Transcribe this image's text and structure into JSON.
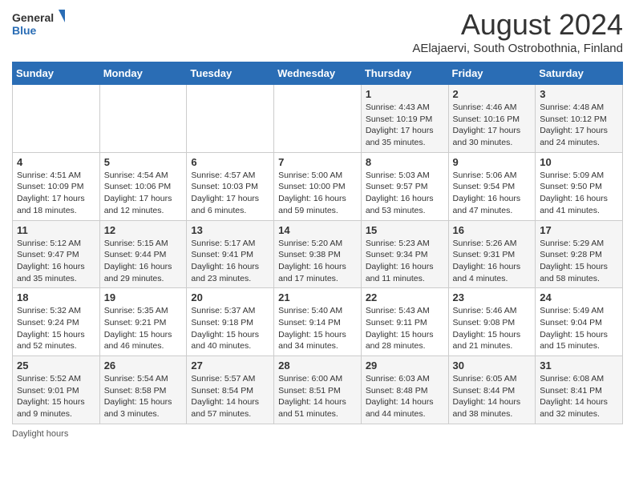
{
  "logo": {
    "text_general": "General",
    "text_blue": "Blue"
  },
  "title": "August 2024",
  "subtitle": "AElajaervi, South Ostrobothnia, Finland",
  "days_of_week": [
    "Sunday",
    "Monday",
    "Tuesday",
    "Wednesday",
    "Thursday",
    "Friday",
    "Saturday"
  ],
  "weeks": [
    [
      {
        "day": "",
        "info": ""
      },
      {
        "day": "",
        "info": ""
      },
      {
        "day": "",
        "info": ""
      },
      {
        "day": "",
        "info": ""
      },
      {
        "day": "1",
        "info": "Sunrise: 4:43 AM\nSunset: 10:19 PM\nDaylight: 17 hours\nand 35 minutes."
      },
      {
        "day": "2",
        "info": "Sunrise: 4:46 AM\nSunset: 10:16 PM\nDaylight: 17 hours\nand 30 minutes."
      },
      {
        "day": "3",
        "info": "Sunrise: 4:48 AM\nSunset: 10:12 PM\nDaylight: 17 hours\nand 24 minutes."
      }
    ],
    [
      {
        "day": "4",
        "info": "Sunrise: 4:51 AM\nSunset: 10:09 PM\nDaylight: 17 hours\nand 18 minutes."
      },
      {
        "day": "5",
        "info": "Sunrise: 4:54 AM\nSunset: 10:06 PM\nDaylight: 17 hours\nand 12 minutes."
      },
      {
        "day": "6",
        "info": "Sunrise: 4:57 AM\nSunset: 10:03 PM\nDaylight: 17 hours\nand 6 minutes."
      },
      {
        "day": "7",
        "info": "Sunrise: 5:00 AM\nSunset: 10:00 PM\nDaylight: 16 hours\nand 59 minutes."
      },
      {
        "day": "8",
        "info": "Sunrise: 5:03 AM\nSunset: 9:57 PM\nDaylight: 16 hours\nand 53 minutes."
      },
      {
        "day": "9",
        "info": "Sunrise: 5:06 AM\nSunset: 9:54 PM\nDaylight: 16 hours\nand 47 minutes."
      },
      {
        "day": "10",
        "info": "Sunrise: 5:09 AM\nSunset: 9:50 PM\nDaylight: 16 hours\nand 41 minutes."
      }
    ],
    [
      {
        "day": "11",
        "info": "Sunrise: 5:12 AM\nSunset: 9:47 PM\nDaylight: 16 hours\nand 35 minutes."
      },
      {
        "day": "12",
        "info": "Sunrise: 5:15 AM\nSunset: 9:44 PM\nDaylight: 16 hours\nand 29 minutes."
      },
      {
        "day": "13",
        "info": "Sunrise: 5:17 AM\nSunset: 9:41 PM\nDaylight: 16 hours\nand 23 minutes."
      },
      {
        "day": "14",
        "info": "Sunrise: 5:20 AM\nSunset: 9:38 PM\nDaylight: 16 hours\nand 17 minutes."
      },
      {
        "day": "15",
        "info": "Sunrise: 5:23 AM\nSunset: 9:34 PM\nDaylight: 16 hours\nand 11 minutes."
      },
      {
        "day": "16",
        "info": "Sunrise: 5:26 AM\nSunset: 9:31 PM\nDaylight: 16 hours\nand 4 minutes."
      },
      {
        "day": "17",
        "info": "Sunrise: 5:29 AM\nSunset: 9:28 PM\nDaylight: 15 hours\nand 58 minutes."
      }
    ],
    [
      {
        "day": "18",
        "info": "Sunrise: 5:32 AM\nSunset: 9:24 PM\nDaylight: 15 hours\nand 52 minutes."
      },
      {
        "day": "19",
        "info": "Sunrise: 5:35 AM\nSunset: 9:21 PM\nDaylight: 15 hours\nand 46 minutes."
      },
      {
        "day": "20",
        "info": "Sunrise: 5:37 AM\nSunset: 9:18 PM\nDaylight: 15 hours\nand 40 minutes."
      },
      {
        "day": "21",
        "info": "Sunrise: 5:40 AM\nSunset: 9:14 PM\nDaylight: 15 hours\nand 34 minutes."
      },
      {
        "day": "22",
        "info": "Sunrise: 5:43 AM\nSunset: 9:11 PM\nDaylight: 15 hours\nand 28 minutes."
      },
      {
        "day": "23",
        "info": "Sunrise: 5:46 AM\nSunset: 9:08 PM\nDaylight: 15 hours\nand 21 minutes."
      },
      {
        "day": "24",
        "info": "Sunrise: 5:49 AM\nSunset: 9:04 PM\nDaylight: 15 hours\nand 15 minutes."
      }
    ],
    [
      {
        "day": "25",
        "info": "Sunrise: 5:52 AM\nSunset: 9:01 PM\nDaylight: 15 hours\nand 9 minutes."
      },
      {
        "day": "26",
        "info": "Sunrise: 5:54 AM\nSunset: 8:58 PM\nDaylight: 15 hours\nand 3 minutes."
      },
      {
        "day": "27",
        "info": "Sunrise: 5:57 AM\nSunset: 8:54 PM\nDaylight: 14 hours\nand 57 minutes."
      },
      {
        "day": "28",
        "info": "Sunrise: 6:00 AM\nSunset: 8:51 PM\nDaylight: 14 hours\nand 51 minutes."
      },
      {
        "day": "29",
        "info": "Sunrise: 6:03 AM\nSunset: 8:48 PM\nDaylight: 14 hours\nand 44 minutes."
      },
      {
        "day": "30",
        "info": "Sunrise: 6:05 AM\nSunset: 8:44 PM\nDaylight: 14 hours\nand 38 minutes."
      },
      {
        "day": "31",
        "info": "Sunrise: 6:08 AM\nSunset: 8:41 PM\nDaylight: 14 hours\nand 32 minutes."
      }
    ]
  ],
  "footer": {
    "daylight_label": "Daylight hours"
  }
}
